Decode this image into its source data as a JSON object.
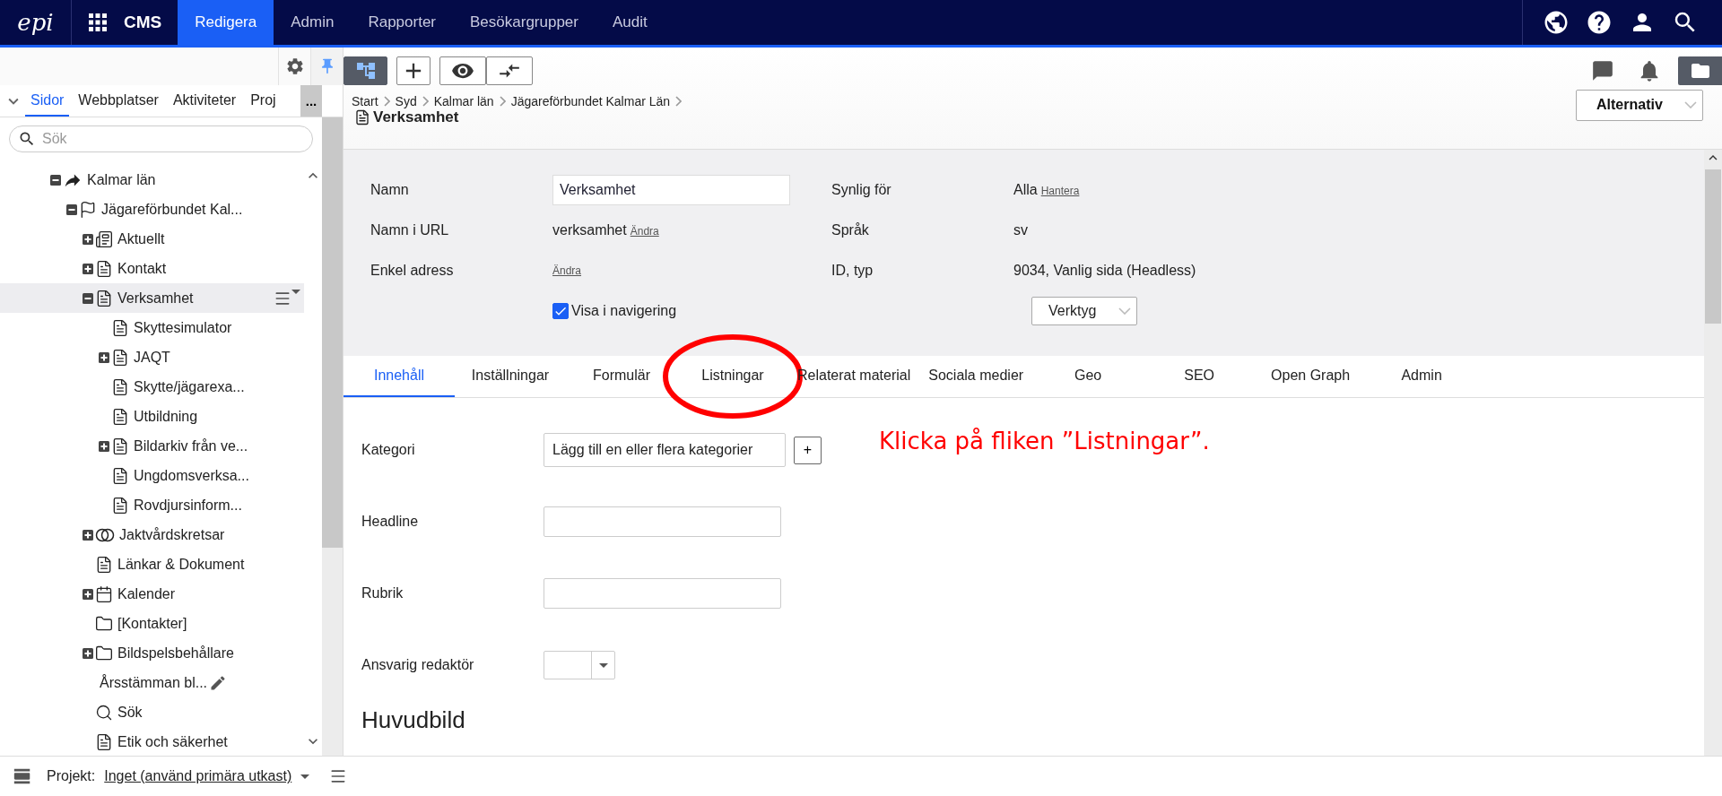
{
  "topbar": {
    "logo": "epi",
    "app": "CMS",
    "nav": [
      {
        "label": "Redigera",
        "selected": true
      },
      {
        "label": "Admin",
        "selected": false
      },
      {
        "label": "Rapporter",
        "selected": false
      },
      {
        "label": "Besökargrupper",
        "selected": false
      },
      {
        "label": "Audit",
        "selected": false
      }
    ]
  },
  "left_panel": {
    "tabs": [
      {
        "label": "Sidor",
        "selected": true
      },
      {
        "label": "Webbplatser",
        "selected": false
      },
      {
        "label": "Aktiviteter",
        "selected": false
      },
      {
        "label": "Proj",
        "selected": false
      }
    ],
    "more": "...",
    "search": {
      "placeholder": "Sök"
    },
    "tree": [
      {
        "label": "Kalmar län",
        "kind": "shortcut",
        "expanded": true,
        "selected": false,
        "children": [
          {
            "label": "Jägareförbundet Kal...",
            "kind": "flag",
            "expanded": true,
            "selected": false,
            "children": [
              {
                "label": "Aktuellt",
                "kind": "news",
                "expanded": false,
                "selected": false
              },
              {
                "label": "Kontakt",
                "kind": "page",
                "expanded": false,
                "selected": false
              },
              {
                "label": "Verksamhet",
                "kind": "page",
                "expanded": true,
                "selected": true,
                "menu_shown": true,
                "children": [
                  {
                    "label": "Skyttesimulator",
                    "kind": "page",
                    "selected": false
                  },
                  {
                    "label": "JAQT",
                    "kind": "page",
                    "expanded": false,
                    "selected": false
                  },
                  {
                    "label": "Skytte/jägarexa...",
                    "kind": "page",
                    "selected": false
                  },
                  {
                    "label": "Utbildning",
                    "kind": "page",
                    "selected": false
                  },
                  {
                    "label": "Bildarkiv från ve...",
                    "kind": "page",
                    "expanded": false,
                    "selected": false
                  },
                  {
                    "label": "Ungdomsverksa...",
                    "kind": "page",
                    "selected": false
                  },
                  {
                    "label": "Rovdjursinform...",
                    "kind": "page",
                    "selected": false
                  }
                ]
              },
              {
                "label": "Jaktvårdskretsar",
                "kind": "circles",
                "expanded": false,
                "selected": false
              },
              {
                "label": "Länkar & Dokument",
                "kind": "page",
                "selected": false
              },
              {
                "label": "Kalender",
                "kind": "calendar",
                "expanded": false,
                "selected": false
              },
              {
                "label": "[Kontakter]",
                "kind": "folder",
                "selected": false
              },
              {
                "label": "Bildspelsbehållare",
                "kind": "folder",
                "expanded": false,
                "selected": false
              },
              {
                "label": "Årsstämman bl...",
                "kind": "news",
                "selected": false,
                "editing": true
              },
              {
                "label": "Sök",
                "kind": "search",
                "selected": false
              },
              {
                "label": "Etik och säkerhet",
                "kind": "page",
                "selected": false
              }
            ]
          }
        ]
      }
    ]
  },
  "toolbar": [
    {
      "kind": "tree",
      "selected": true
    },
    {
      "kind": "add",
      "selected": false
    },
    {
      "kind": "preview",
      "selected": false
    },
    {
      "kind": "compare",
      "selected": false
    }
  ],
  "right_tools": [
    {
      "kind": "comments",
      "selected": false
    },
    {
      "kind": "notifications",
      "selected": false
    },
    {
      "kind": "assets",
      "selected": true
    }
  ],
  "breadcrumb": [
    "Start",
    "Syd",
    "Kalmar län",
    "Jägareförbundet Kalmar Län"
  ],
  "page_title": "Verksamhet",
  "options_button": "Alternativ",
  "properties": {
    "left": [
      {
        "label": "Namn",
        "kind": "input",
        "value": "Verksamhet"
      },
      {
        "label": "Namn i URL",
        "kind": "text",
        "value": "verksamhet",
        "link": "Ändra"
      },
      {
        "label": "Enkel adress",
        "kind": "text",
        "link": "Ändra"
      }
    ],
    "right": [
      {
        "label": "Synlig för",
        "kind": "text",
        "value": "Alla",
        "link": "Hantera"
      },
      {
        "label": "Språk",
        "kind": "text",
        "value": "sv"
      },
      {
        "label": "ID, typ",
        "kind": "text",
        "value": "9034, Vanlig sida (Headless)"
      }
    ],
    "show_in_nav": {
      "label": "Visa i navigering",
      "checked": true
    },
    "tools_button": "Verktyg"
  },
  "tabs": [
    {
      "label": "Innehåll",
      "selected": true
    },
    {
      "label": "Inställningar",
      "selected": false
    },
    {
      "label": "Formulär",
      "selected": false
    },
    {
      "label": "Listningar",
      "selected": false,
      "circled": true
    },
    {
      "label": "Relaterat material",
      "selected": false
    },
    {
      "label": "Sociala medier",
      "selected": false
    },
    {
      "label": "Geo",
      "selected": false
    },
    {
      "label": "SEO",
      "selected": false
    },
    {
      "label": "Open Graph",
      "selected": false
    },
    {
      "label": "Admin",
      "selected": false
    }
  ],
  "content": {
    "fields": [
      {
        "label": "Kategori",
        "kind": "category",
        "value": "Lägg till en eller flera kategorier",
        "button": "+"
      },
      {
        "label": "Headline",
        "kind": "text"
      },
      {
        "label": "Rubrik",
        "kind": "text"
      },
      {
        "label": "Ansvarig redaktör",
        "kind": "select"
      }
    ],
    "heading": "Huvudbild"
  },
  "annotation": {
    "text": "Klicka på fliken ”Listningar”."
  },
  "footer": {
    "label": "Projekt:",
    "project": "Inget (använd primära utkast)"
  }
}
